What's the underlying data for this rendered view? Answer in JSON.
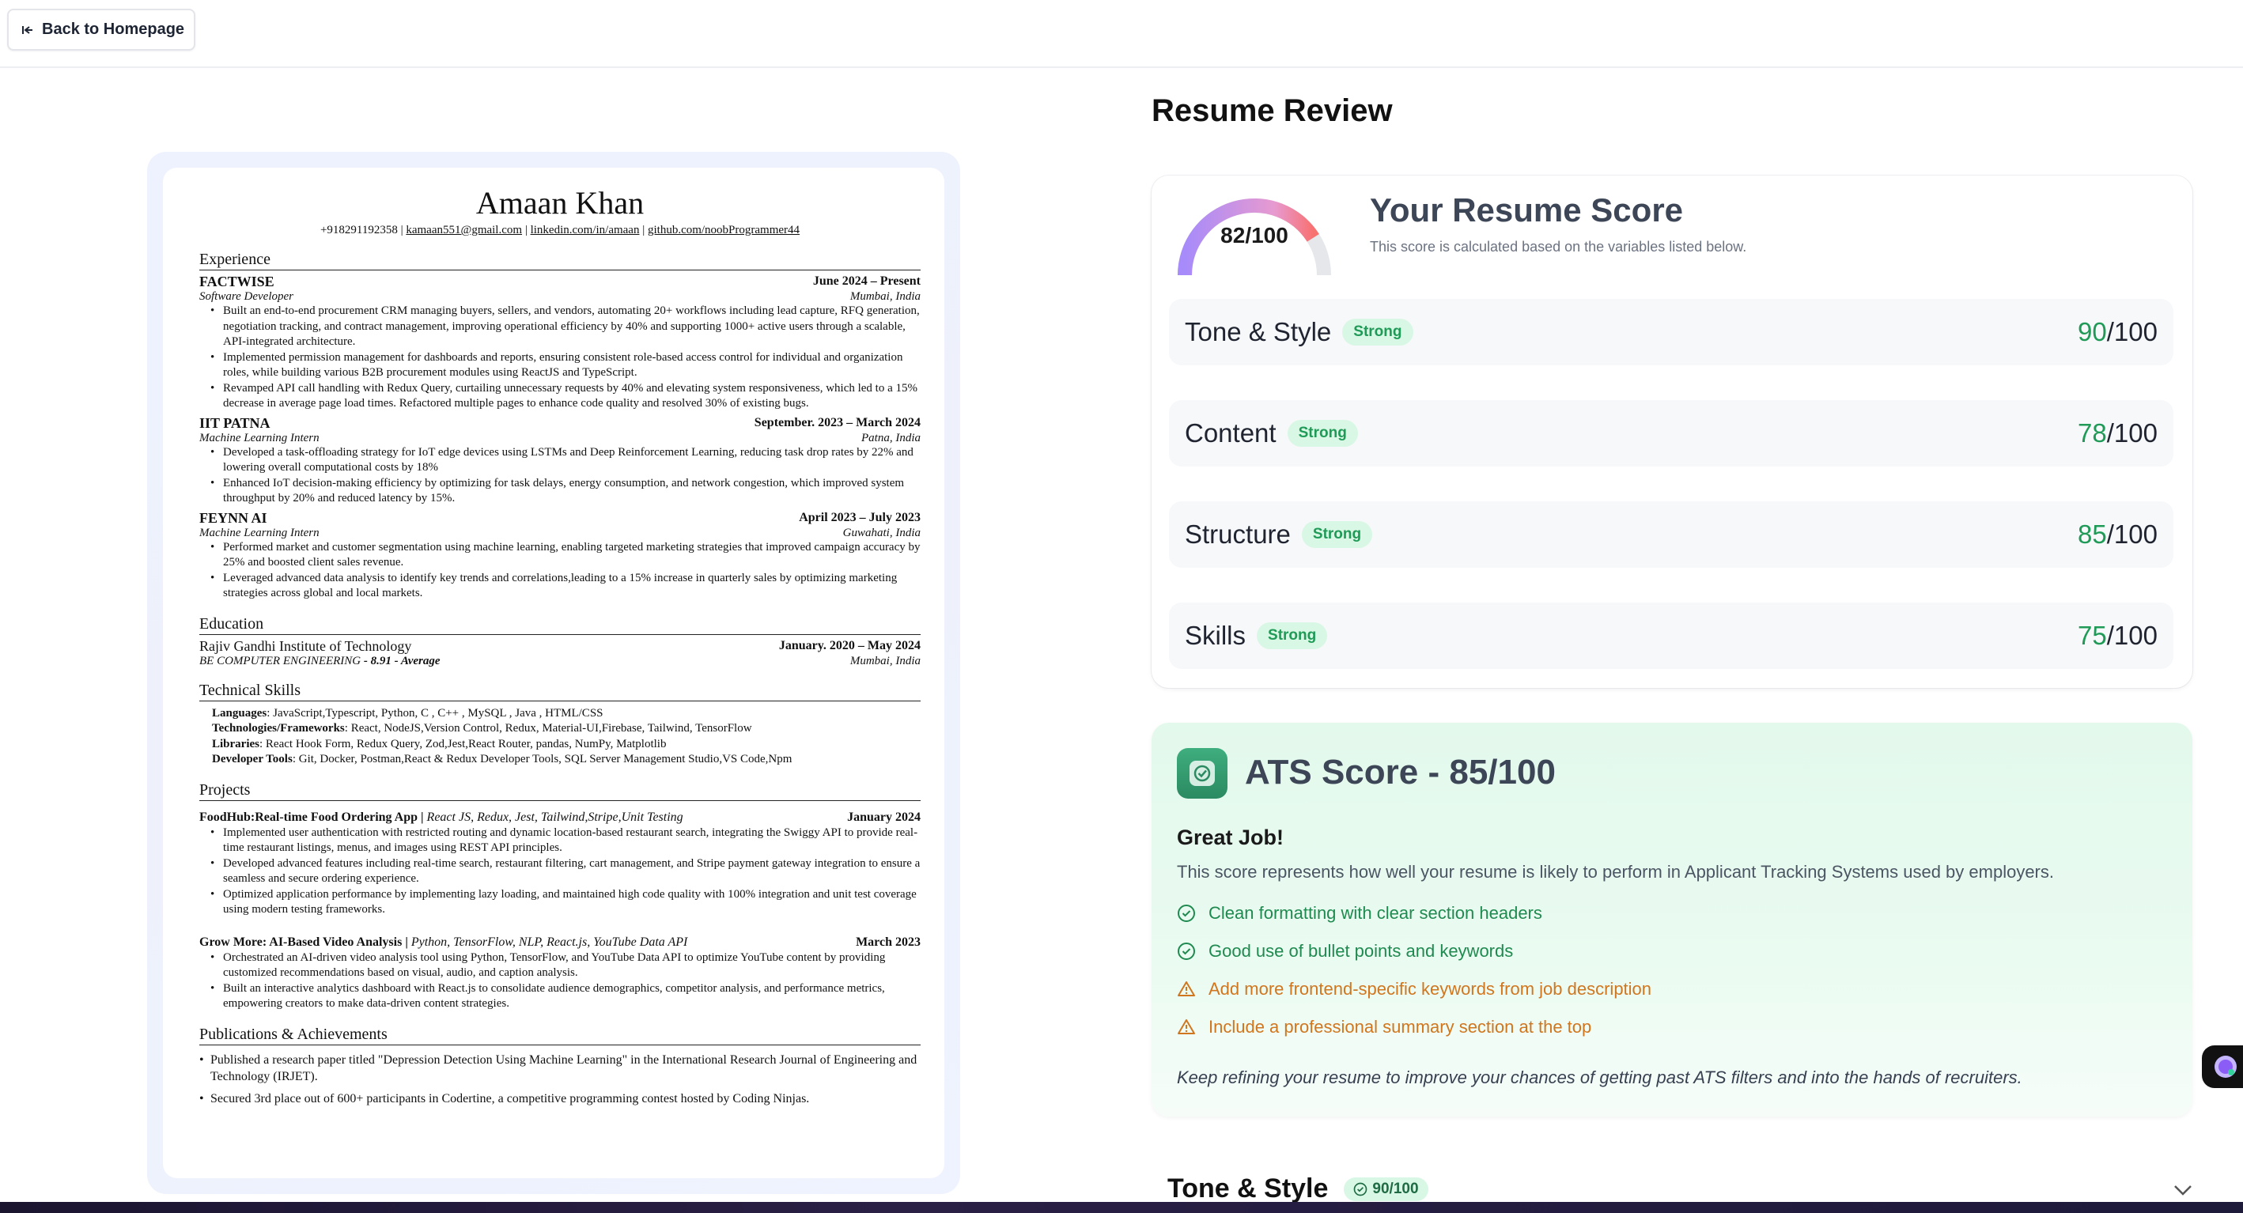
{
  "topbar": {
    "back_label": "Back to Homepage"
  },
  "resume": {
    "name": "Amaan Khan",
    "contact": {
      "phone": "+918291192358",
      "email": "kamaan551@gmail.com",
      "linkedin": "linkedin.com/in/amaan",
      "github": "github.com/noobProgrammer44"
    },
    "sections": {
      "experience": "Experience",
      "education": "Education",
      "skills": "Technical Skills",
      "projects": "Projects",
      "publications": "Publications & Achievements"
    },
    "experience": [
      {
        "org": "FACTWISE",
        "dates": "June 2024 – Present",
        "role": "Software Developer",
        "location": "Mumbai, India",
        "bullets": [
          "Built an end-to-end procurement CRM managing buyers, sellers, and vendors, automating 20+ workflows including lead capture, RFQ generation, negotiation tracking, and contract management, improving operational efficiency by 40% and supporting 1000+ active users through a scalable, API-integrated architecture.",
          "Implemented permission management for dashboards and reports, ensuring consistent role-based access control for individual and organization roles, while building various B2B procurement modules using ReactJS and TypeScript.",
          "Revamped API call handling with Redux Query, curtailing unnecessary requests by 40% and elevating system responsiveness, which led to a 15% decrease in average page load times. Refactored multiple pages to enhance code quality and resolved 30% of existing bugs."
        ]
      },
      {
        "org": "IIT PATNA",
        "dates": "September. 2023 – March 2024",
        "role": "Machine Learning Intern",
        "location": "Patna, India",
        "bullets": [
          "Developed a task-offloading strategy for IoT edge devices using LSTMs and Deep Reinforcement Learning, reducing task drop rates by 22% and lowering overall computational costs by 18%",
          "Enhanced IoT decision-making efficiency by optimizing for task delays, energy consumption, and network congestion, which improved system throughput by 20% and reduced latency by 15%."
        ]
      },
      {
        "org": "FEYNN AI",
        "dates": "April 2023 – July 2023",
        "role": "Machine Learning Intern",
        "location": "Guwahati, India",
        "bullets": [
          "Performed market and customer segmentation using machine learning, enabling targeted marketing strategies that improved campaign accuracy by 25% and boosted client sales revenue.",
          "Leveraged advanced data analysis to identify key trends and correlations,leading to a 15% increase in quarterly sales by optimizing marketing strategies across global and local markets."
        ]
      }
    ],
    "education": {
      "school": "Rajiv Gandhi Institute of Technology",
      "dates": "January. 2020 – May 2024",
      "degree": "BE COMPUTER ENGINEERING",
      "grade": "- 8.91 - Average",
      "location": "Mumbai, India"
    },
    "skills": [
      {
        "label": "Languages",
        "value": ": JavaScript,Typescript, Python, C , C++ , MySQL , Java , HTML/CSS"
      },
      {
        "label": "Technologies/Frameworks",
        "value": ": React, NodeJS,Version Control, Redux, Material-UI,Firebase, Tailwind, TensorFlow"
      },
      {
        "label": "Libraries",
        "value": ": React Hook Form, Redux Query, Zod,Jest,React Router, pandas, NumPy, Matplotlib"
      },
      {
        "label": "Developer Tools",
        "value": ": Git, Docker, Postman,React & Redux Developer Tools, SQL Server Management Studio,VS Code,Npm"
      }
    ],
    "projects": [
      {
        "name": "FoodHub:Real-time Food Ordering App",
        "stack": "React JS, Redux, Jest, Tailwind,Stripe,Unit Testing",
        "date": "January 2024",
        "bullets": [
          "Implemented user authentication with restricted routing and dynamic location-based restaurant search, integrating the Swiggy API to provide real-time restaurant listings, menus, and images using REST API principles.",
          "Developed advanced features including real-time search, restaurant filtering, cart management, and Stripe payment gateway integration to ensure a seamless and secure ordering experience.",
          "Optimized application performance by implementing lazy loading, and maintained high code quality with 100% integration and unit test coverage using modern testing frameworks."
        ]
      },
      {
        "name": "Grow More: AI-Based Video Analysis",
        "stack": "Python, TensorFlow, NLP, React.js, YouTube Data API",
        "date": "March 2023",
        "bullets": [
          "Orchestrated an AI-driven video analysis tool using Python, TensorFlow, and YouTube Data API to optimize YouTube content by providing customized recommendations based on visual, audio, and caption analysis.",
          "Built an interactive analytics dashboard with React.js to consolidate audience demographics, competitor analysis, and performance metrics, empowering creators to make data-driven content strategies."
        ]
      }
    ],
    "publications": [
      "Published a research paper titled \"Depression Detection Using Machine Learning\" in the International Research Journal of Engineering and Technology (IRJET).",
      "Secured 3rd place out of 600+ participants in Codertine, a competitive programming contest hosted by Coding Ninjas."
    ]
  },
  "review": {
    "title": "Resume Review",
    "overall": {
      "value": 82,
      "label": "82/100",
      "heading": "Your Resume Score",
      "description": "This score is calculated based on the variables listed below."
    },
    "categories": [
      {
        "name": "Tone & Style",
        "badge": "Strong",
        "score": "90",
        "suffix": "/100"
      },
      {
        "name": "Content",
        "badge": "Strong",
        "score": "78",
        "suffix": "/100"
      },
      {
        "name": "Structure",
        "badge": "Strong",
        "score": "85",
        "suffix": "/100"
      },
      {
        "name": "Skills",
        "badge": "Strong",
        "score": "75",
        "suffix": "/100"
      }
    ],
    "ats": {
      "title": "ATS Score - 85/100",
      "heading": "Great Job!",
      "description": "This score represents how well your resume is likely to perform in Applicant Tracking Systems used by employers.",
      "items": [
        {
          "type": "good",
          "text": "Clean formatting with clear section headers"
        },
        {
          "type": "good",
          "text": "Good use of bullet points and keywords"
        },
        {
          "type": "warn",
          "text": "Add more frontend-specific keywords from job description"
        },
        {
          "type": "warn",
          "text": "Include a professional summary section at the top"
        }
      ],
      "footer": "Keep refining your resume to improve your chances of getting past ATS filters and into the hands of recruiters."
    },
    "tone_section": {
      "title": "Tone & Style",
      "badge": "90/100"
    }
  },
  "colors": {
    "good": "#1f9a57",
    "warn": "#d0761f",
    "accent_gauge_start": "#a78bfa",
    "accent_gauge_end": "#f87171"
  }
}
